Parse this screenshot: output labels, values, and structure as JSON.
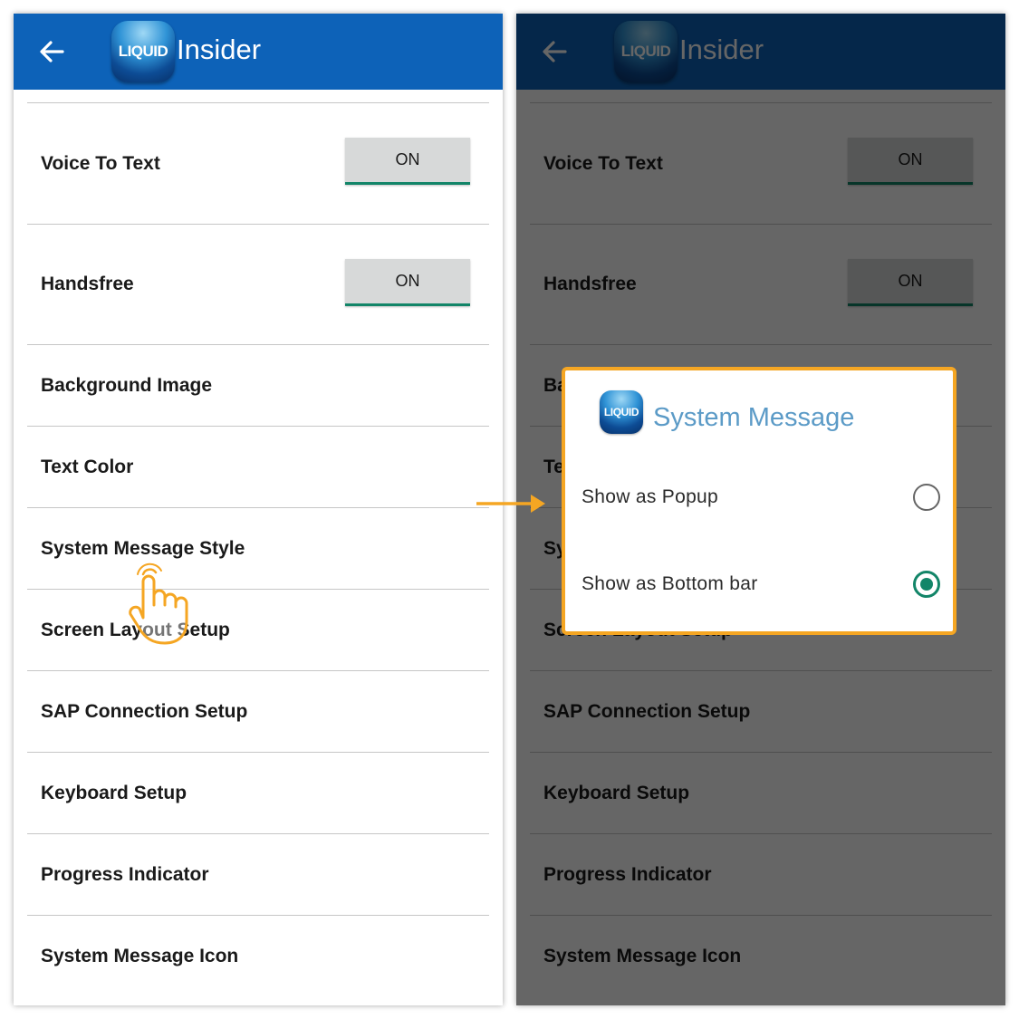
{
  "app": {
    "logo_text": "LIQUID",
    "title": "Insider"
  },
  "settings": [
    {
      "label": "Voice To Text",
      "toggle": "ON"
    },
    {
      "label": "Handsfree",
      "toggle": "ON"
    },
    {
      "label": "Background Image"
    },
    {
      "label": "Text Color"
    },
    {
      "label": "System Message Style"
    },
    {
      "label": "Screen Layout Setup"
    },
    {
      "label": "SAP Connection Setup"
    },
    {
      "label": "Keyboard Setup"
    },
    {
      "label": "Progress Indicator"
    },
    {
      "label": "System Message Icon"
    }
  ],
  "dialog": {
    "logo_text": "LIQUID",
    "title": "System Message",
    "options": [
      {
        "label": "Show as Popup",
        "selected": false
      },
      {
        "label": "Show as Bottom bar",
        "selected": true
      }
    ]
  },
  "colors": {
    "appbar": "#0d62b8",
    "toggle_underline": "#128568",
    "dialog_border": "#f5a623",
    "dialog_title": "#5c9bc7",
    "radio_selected": "#128568"
  },
  "icons": {
    "back": "arrow-left-icon",
    "pointer": "hand-pointer-icon",
    "transition": "arrow-right-icon"
  }
}
